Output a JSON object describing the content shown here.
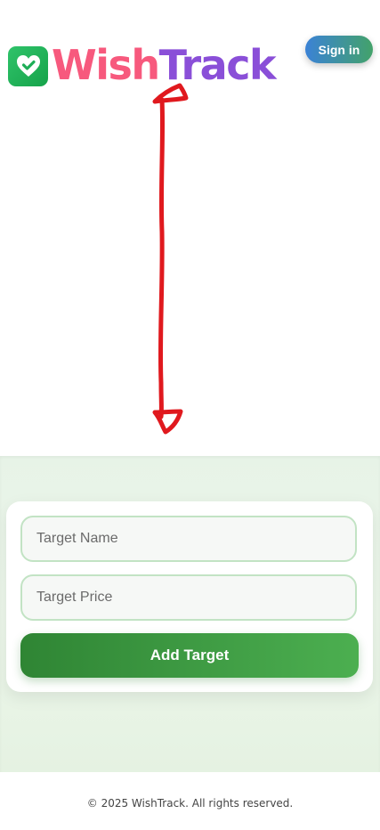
{
  "header": {
    "brand": {
      "part1": "Wish",
      "part2": "Track",
      "icon": "heart-check-icon"
    },
    "signin_label": "Sign in"
  },
  "annotation": {
    "icon": "double-headed-arrow",
    "color": "#e0191e"
  },
  "form": {
    "target_name_placeholder": "Target Name",
    "target_price_placeholder": "Target Price",
    "submit_label": "Add Target"
  },
  "footer": {
    "copyright": "© 2025 WishTrack. All rights reserved."
  },
  "colors": {
    "brand_pink": "#f7597d",
    "brand_purple": "#8a4fd8",
    "accent_green": "#4caf50",
    "section_bg": "#e9f4e8"
  }
}
